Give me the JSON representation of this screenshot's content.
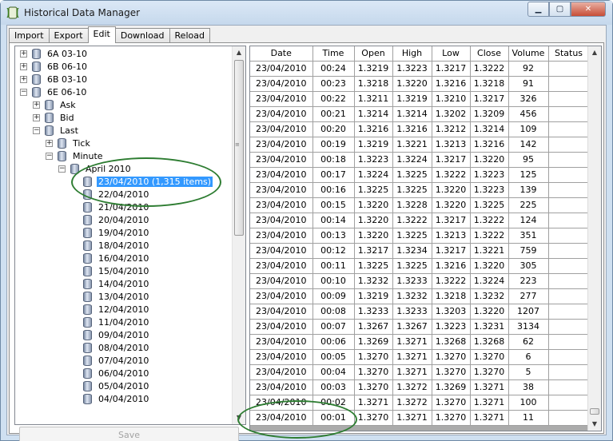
{
  "window": {
    "title": "Historical Data Manager"
  },
  "tabs": [
    "Import",
    "Export",
    "Edit",
    "Download",
    "Reload"
  ],
  "active_tab": "Edit",
  "tree": [
    {
      "label": "6A 03-10",
      "level": 0,
      "expander": "+",
      "icon": "database-icon"
    },
    {
      "label": "6B 06-10",
      "level": 0,
      "expander": "+",
      "icon": "database-icon"
    },
    {
      "label": "6B 03-10",
      "level": 0,
      "expander": "+",
      "icon": "database-icon"
    },
    {
      "label": "6E 06-10",
      "level": 0,
      "expander": "−",
      "icon": "database-icon"
    },
    {
      "label": "Ask",
      "level": 1,
      "expander": "+",
      "icon": "database-icon"
    },
    {
      "label": "Bid",
      "level": 1,
      "expander": "+",
      "icon": "database-icon"
    },
    {
      "label": "Last",
      "level": 1,
      "expander": "−",
      "icon": "database-icon"
    },
    {
      "label": "Tick",
      "level": 2,
      "expander": "+",
      "icon": "database-icon"
    },
    {
      "label": "Minute",
      "level": 2,
      "expander": "−",
      "icon": "database-icon"
    },
    {
      "label": "April 2010",
      "level": 3,
      "expander": "−",
      "icon": "database-icon"
    },
    {
      "label": "23/04/2010 (1,315 items)",
      "level": 4,
      "expander": "",
      "icon": "database-icon",
      "selected": true
    },
    {
      "label": "22/04/2010",
      "level": 4,
      "expander": "",
      "icon": "database-icon"
    },
    {
      "label": "21/04/2010",
      "level": 4,
      "expander": "",
      "icon": "database-icon"
    },
    {
      "label": "20/04/2010",
      "level": 4,
      "expander": "",
      "icon": "database-icon"
    },
    {
      "label": "19/04/2010",
      "level": 4,
      "expander": "",
      "icon": "database-icon"
    },
    {
      "label": "18/04/2010",
      "level": 4,
      "expander": "",
      "icon": "database-icon"
    },
    {
      "label": "16/04/2010",
      "level": 4,
      "expander": "",
      "icon": "database-icon"
    },
    {
      "label": "15/04/2010",
      "level": 4,
      "expander": "",
      "icon": "database-icon"
    },
    {
      "label": "14/04/2010",
      "level": 4,
      "expander": "",
      "icon": "database-icon"
    },
    {
      "label": "13/04/2010",
      "level": 4,
      "expander": "",
      "icon": "database-icon"
    },
    {
      "label": "12/04/2010",
      "level": 4,
      "expander": "",
      "icon": "database-icon"
    },
    {
      "label": "11/04/2010",
      "level": 4,
      "expander": "",
      "icon": "database-icon"
    },
    {
      "label": "09/04/2010",
      "level": 4,
      "expander": "",
      "icon": "database-icon"
    },
    {
      "label": "08/04/2010",
      "level": 4,
      "expander": "",
      "icon": "database-icon"
    },
    {
      "label": "07/04/2010",
      "level": 4,
      "expander": "",
      "icon": "database-icon"
    },
    {
      "label": "06/04/2010",
      "level": 4,
      "expander": "",
      "icon": "database-icon"
    },
    {
      "label": "05/04/2010",
      "level": 4,
      "expander": "",
      "icon": "database-icon"
    },
    {
      "label": "04/04/2010",
      "level": 4,
      "expander": "",
      "icon": "database-icon"
    }
  ],
  "save_label": "Save",
  "grid": {
    "columns": [
      "Date",
      "Time",
      "Open",
      "High",
      "Low",
      "Close",
      "Volume",
      "Status"
    ],
    "rows": [
      [
        "23/04/2010",
        "00:24",
        "1.3219",
        "1.3223",
        "1.3217",
        "1.3222",
        "92",
        ""
      ],
      [
        "23/04/2010",
        "00:23",
        "1.3218",
        "1.3220",
        "1.3216",
        "1.3218",
        "91",
        ""
      ],
      [
        "23/04/2010",
        "00:22",
        "1.3211",
        "1.3219",
        "1.3210",
        "1.3217",
        "326",
        ""
      ],
      [
        "23/04/2010",
        "00:21",
        "1.3214",
        "1.3214",
        "1.3202",
        "1.3209",
        "456",
        ""
      ],
      [
        "23/04/2010",
        "00:20",
        "1.3216",
        "1.3216",
        "1.3212",
        "1.3214",
        "109",
        ""
      ],
      [
        "23/04/2010",
        "00:19",
        "1.3219",
        "1.3221",
        "1.3213",
        "1.3216",
        "142",
        ""
      ],
      [
        "23/04/2010",
        "00:18",
        "1.3223",
        "1.3224",
        "1.3217",
        "1.3220",
        "95",
        ""
      ],
      [
        "23/04/2010",
        "00:17",
        "1.3224",
        "1.3225",
        "1.3222",
        "1.3223",
        "125",
        ""
      ],
      [
        "23/04/2010",
        "00:16",
        "1.3225",
        "1.3225",
        "1.3220",
        "1.3223",
        "139",
        ""
      ],
      [
        "23/04/2010",
        "00:15",
        "1.3220",
        "1.3228",
        "1.3220",
        "1.3225",
        "225",
        ""
      ],
      [
        "23/04/2010",
        "00:14",
        "1.3220",
        "1.3222",
        "1.3217",
        "1.3222",
        "124",
        ""
      ],
      [
        "23/04/2010",
        "00:13",
        "1.3220",
        "1.3225",
        "1.3213",
        "1.3222",
        "351",
        ""
      ],
      [
        "23/04/2010",
        "00:12",
        "1.3217",
        "1.3234",
        "1.3217",
        "1.3221",
        "759",
        ""
      ],
      [
        "23/04/2010",
        "00:11",
        "1.3225",
        "1.3225",
        "1.3216",
        "1.3220",
        "305",
        ""
      ],
      [
        "23/04/2010",
        "00:10",
        "1.3232",
        "1.3233",
        "1.3222",
        "1.3224",
        "223",
        ""
      ],
      [
        "23/04/2010",
        "00:09",
        "1.3219",
        "1.3232",
        "1.3218",
        "1.3232",
        "277",
        ""
      ],
      [
        "23/04/2010",
        "00:08",
        "1.3233",
        "1.3233",
        "1.3203",
        "1.3220",
        "1207",
        ""
      ],
      [
        "23/04/2010",
        "00:07",
        "1.3267",
        "1.3267",
        "1.3223",
        "1.3231",
        "3134",
        ""
      ],
      [
        "23/04/2010",
        "00:06",
        "1.3269",
        "1.3271",
        "1.3268",
        "1.3268",
        "62",
        ""
      ],
      [
        "23/04/2010",
        "00:05",
        "1.3270",
        "1.3271",
        "1.3270",
        "1.3270",
        "6",
        ""
      ],
      [
        "23/04/2010",
        "00:04",
        "1.3270",
        "1.3271",
        "1.3270",
        "1.3270",
        "5",
        ""
      ],
      [
        "23/04/2010",
        "00:03",
        "1.3270",
        "1.3272",
        "1.3269",
        "1.3271",
        "38",
        ""
      ],
      [
        "23/04/2010",
        "00:02",
        "1.3271",
        "1.3272",
        "1.3270",
        "1.3271",
        "100",
        ""
      ],
      [
        "23/04/2010",
        "00:01",
        "1.3270",
        "1.3271",
        "1.3270",
        "1.3271",
        "11",
        ""
      ]
    ]
  },
  "colors": {
    "selection": "#3399ff",
    "annotation": "#2e7d32"
  }
}
